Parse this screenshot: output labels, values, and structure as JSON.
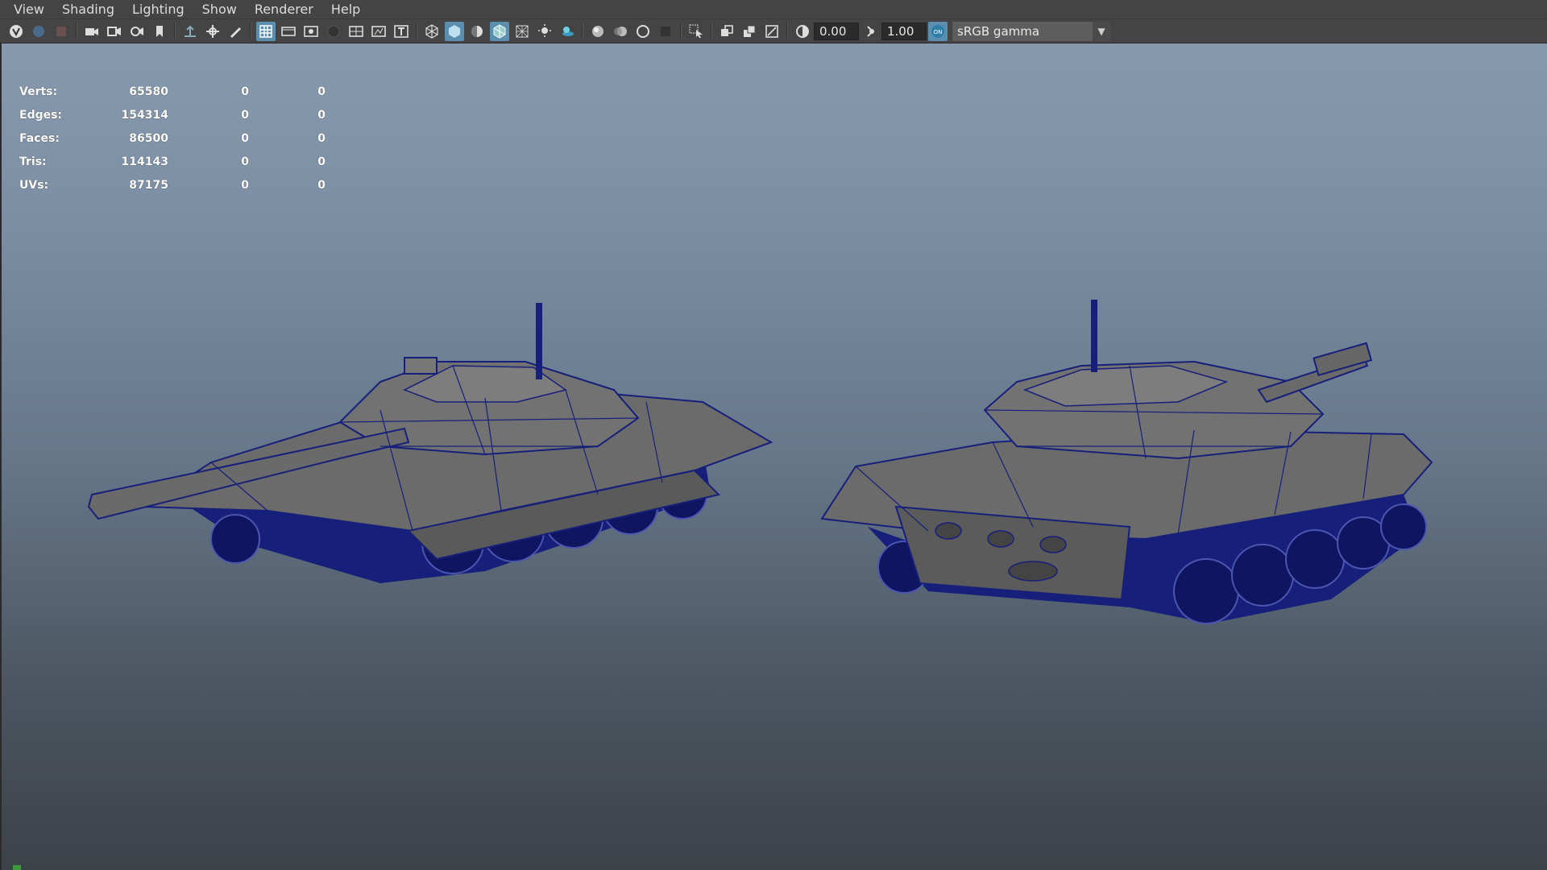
{
  "menu": [
    "View",
    "Shading",
    "Lighting",
    "Show",
    "Renderer",
    "Help"
  ],
  "toolbar": {
    "exposure": "0.00",
    "gamma": "1.00",
    "colorspace": "sRGB gamma",
    "icons": [
      "select-camera-icon",
      "camera-attributes-icon",
      "bookmark-icon",
      "image-plane-icon",
      "video-camera-icon",
      "camera-sequence-icon",
      "bookmark-flag-icon",
      "snap-icon",
      "pan-zoom-icon",
      "grease-pencil-icon",
      "grid-icon",
      "film-gate-icon",
      "resolution-gate-icon",
      "gate-mask-icon",
      "field-chart-icon",
      "safe-action-icon",
      "safe-title-icon",
      "wireframe-icon",
      "smooth-shade-icon",
      "default-material-icon",
      "wireframe-on-shaded-icon",
      "xray-icon",
      "use-lights-icon",
      "shadows-icon",
      "screen-space-ao-icon",
      "motion-blur-icon",
      "anti-aliasing-icon",
      "depth-of-field-icon",
      "isolate-select-icon",
      "xray-joints-icon",
      "xray-active-icon",
      "backface-culling-icon",
      "exposure-icon",
      "gamma-icon",
      "color-management-icon"
    ]
  },
  "hud": {
    "rows": [
      {
        "label": "Verts:",
        "v1": "65580",
        "v2": "0",
        "v3": "0"
      },
      {
        "label": "Edges:",
        "v1": "154314",
        "v2": "0",
        "v3": "0"
      },
      {
        "label": "Faces:",
        "v1": "86500",
        "v2": "0",
        "v3": "0"
      },
      {
        "label": "Tris:",
        "v1": "114143",
        "v2": "0",
        "v3": "0"
      },
      {
        "label": "UVs:",
        "v1": "87175",
        "v2": "0",
        "v3": "0"
      }
    ]
  },
  "colors": {
    "wireframe": "#16207a",
    "mesh": "#6e6e6e",
    "accent": "#5a8fb0"
  }
}
